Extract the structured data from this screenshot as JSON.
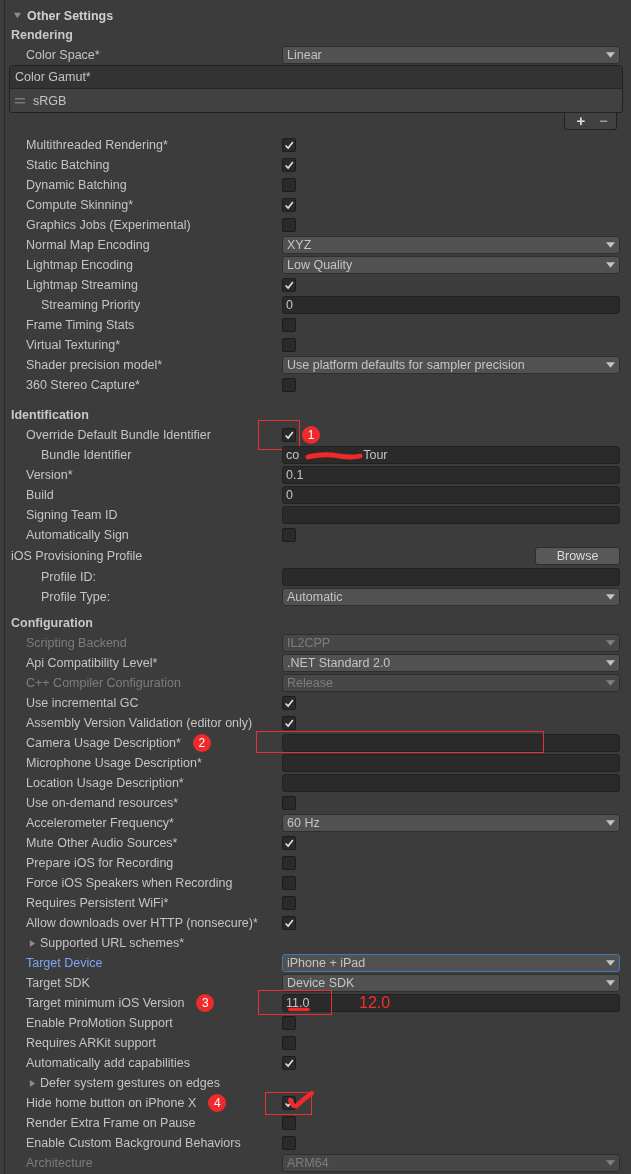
{
  "panel": {
    "title": "Other Settings",
    "expanded": true
  },
  "sections": [
    {
      "heading": "Rendering",
      "rows": [
        {
          "kind": "dropdown",
          "label": "Color Space*",
          "value": "Linear"
        },
        {
          "kind": "list",
          "label": "Color Gamut*",
          "items": [
            "sRGB"
          ],
          "add": "+",
          "remove": "−"
        },
        {
          "kind": "checkbox",
          "label": "Multithreaded Rendering*",
          "checked": true
        },
        {
          "kind": "checkbox",
          "label": "Static Batching",
          "checked": true
        },
        {
          "kind": "checkbox",
          "label": "Dynamic Batching",
          "checked": false
        },
        {
          "kind": "checkbox",
          "label": "Compute Skinning*",
          "checked": true
        },
        {
          "kind": "checkbox",
          "label": "Graphics Jobs (Experimental)",
          "checked": false
        },
        {
          "kind": "dropdown",
          "label": "Normal Map Encoding",
          "value": "XYZ"
        },
        {
          "kind": "dropdown",
          "label": "Lightmap Encoding",
          "value": "Low Quality"
        },
        {
          "kind": "checkbox",
          "label": "Lightmap Streaming",
          "checked": true,
          "children": [
            {
              "kind": "field",
              "label": "Streaming Priority",
              "value": "0"
            }
          ]
        },
        {
          "kind": "checkbox",
          "label": "Frame Timing Stats",
          "checked": false
        },
        {
          "kind": "checkbox",
          "label": "Virtual Texturing*",
          "checked": false
        },
        {
          "kind": "dropdown",
          "label": "Shader precision model*",
          "value": "Use platform defaults for sampler precision"
        },
        {
          "kind": "checkbox",
          "label": "360 Stereo Capture*",
          "checked": false
        }
      ]
    },
    {
      "heading": "Identification",
      "rows": [
        {
          "kind": "checkbox",
          "label": "Override Default Bundle Identifier",
          "checked": true,
          "annotation": {
            "number": "1",
            "badge_on_control": true,
            "boxed": true
          },
          "children": [
            {
              "kind": "field",
              "label": "Bundle Identifier",
              "value": "co",
              "value_end": "Tour",
              "scribbled": true
            }
          ]
        },
        {
          "kind": "field",
          "label": "Version*",
          "value": "0.1"
        },
        {
          "kind": "field",
          "label": "Build",
          "value": "0"
        },
        {
          "kind": "field",
          "label": "Signing Team ID"
        },
        {
          "kind": "checkbox",
          "label": "Automatically Sign",
          "checked": false
        },
        {
          "kind": "button",
          "label": "iOS Provisioning Profile",
          "button": "Browse",
          "children": [
            {
              "kind": "field",
              "label": "Profile ID:"
            },
            {
              "kind": "dropdown",
              "label": "Profile Type:",
              "value": "Automatic"
            }
          ]
        }
      ]
    },
    {
      "heading": "Configuration",
      "rows": [
        {
          "kind": "dropdown",
          "label": "Scripting Backend",
          "value": "IL2CPP",
          "disabled": true
        },
        {
          "kind": "dropdown",
          "label": "Api Compatibility Level*",
          "value": ".NET Standard 2.0"
        },
        {
          "kind": "dropdown",
          "label": "C++ Compiler Configuration",
          "value": "Release",
          "disabled": true
        },
        {
          "kind": "checkbox",
          "label": "Use incremental GC",
          "checked": true
        },
        {
          "kind": "checkbox",
          "label": "Assembly Version Validation (editor only)",
          "checked": true
        },
        {
          "kind": "field",
          "label": "Camera Usage Description*",
          "annotation": {
            "number": "2",
            "boxed": true
          }
        },
        {
          "kind": "field",
          "label": "Microphone Usage Description*"
        },
        {
          "kind": "field",
          "label": "Location Usage Description*"
        },
        {
          "kind": "checkbox",
          "label": "Use on-demand resources*",
          "checked": false
        },
        {
          "kind": "dropdown",
          "label": "Accelerometer Frequency*",
          "value": "60 Hz"
        },
        {
          "kind": "checkbox",
          "label": "Mute Other Audio Sources*",
          "checked": true
        },
        {
          "kind": "checkbox",
          "label": "Prepare iOS for Recording",
          "checked": false
        },
        {
          "kind": "checkbox",
          "label": "Force iOS Speakers when Recording",
          "checked": false
        },
        {
          "kind": "checkbox",
          "label": "Requires Persistent WiFi*",
          "checked": false
        },
        {
          "kind": "checkbox",
          "label": "Allow downloads over HTTP (nonsecure)*",
          "checked": true
        },
        {
          "kind": "foldout",
          "label": "Supported URL schemes*",
          "expanded": false
        },
        {
          "kind": "dropdown",
          "label": "Target Device",
          "value": "iPhone + iPad",
          "focused": true
        },
        {
          "kind": "dropdown",
          "label": "Target SDK",
          "value": "Device SDK"
        },
        {
          "kind": "field",
          "label": "Target minimum iOS Version",
          "value": "11.0",
          "scribbled": true,
          "annotation": {
            "number": "3",
            "boxed": true,
            "note": "12.0"
          }
        },
        {
          "kind": "checkbox",
          "label": "Enable ProMotion Support",
          "checked": false
        },
        {
          "kind": "checkbox",
          "label": "Requires ARKit support",
          "checked": false
        },
        {
          "kind": "checkbox",
          "label": "Automatically add capabilities",
          "checked": true
        },
        {
          "kind": "foldout",
          "label": "Defer system gestures on edges",
          "expanded": false
        },
        {
          "kind": "checkbox",
          "label": "Hide home button on iPhone X",
          "checked": true,
          "annotation": {
            "number": "4",
            "boxed": true,
            "red_check": true
          }
        },
        {
          "kind": "checkbox",
          "label": "Render Extra Frame on Pause",
          "checked": false
        },
        {
          "kind": "checkbox",
          "label": "Enable Custom Background Behaviors",
          "checked": false
        },
        {
          "kind": "dropdown",
          "label": "Architecture",
          "value": "ARM64",
          "disabled": true
        }
      ]
    }
  ]
}
